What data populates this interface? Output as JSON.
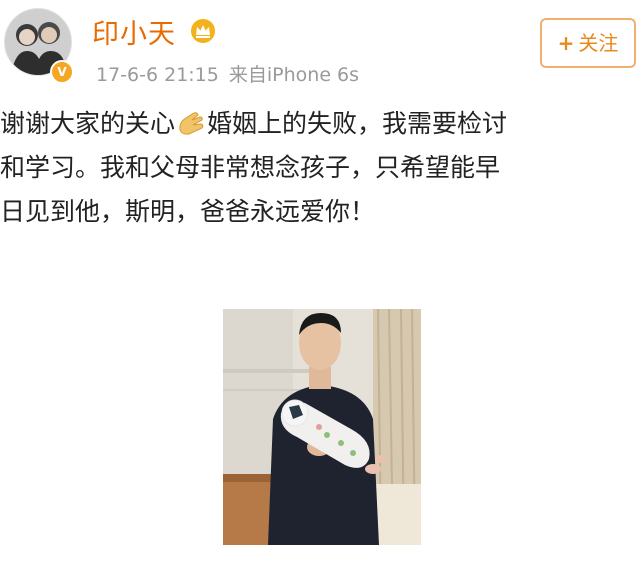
{
  "author": {
    "name": "印小天",
    "avatar_icon": "avatar",
    "verified_icon": "verified-v-icon",
    "name_badge_icon": "crown-icon",
    "name_color": "#e86a00"
  },
  "meta": {
    "timestamp": "17-6-6 21:15",
    "source": "来自iPhone 6s"
  },
  "follow_button": {
    "label": "关注",
    "plus": "+"
  },
  "post": {
    "lines": [
      {
        "before": "谢谢大家的关心",
        "emoji": "clap-emoji",
        "after": "婚姻上的失败，我需要检讨"
      },
      {
        "text": "和学习。我和父母非常想念孩子，只希望能早"
      },
      {
        "text": "日见到他，斯明，爸爸永远爱你！"
      }
    ]
  },
  "photo": {
    "icon": "photo-man-holding-baby"
  },
  "colors": {
    "accent": "#e8891c",
    "text": "#222222",
    "meta": "#9a9a9a"
  }
}
